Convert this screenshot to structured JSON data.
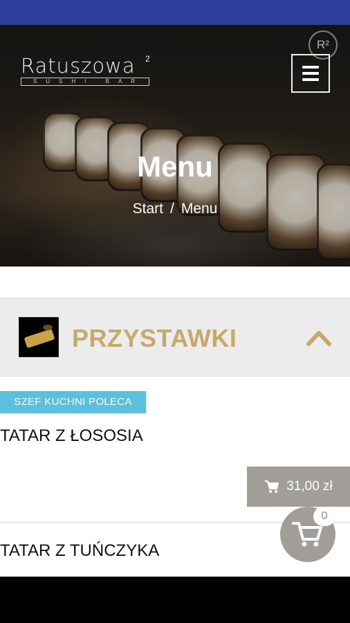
{
  "header": {
    "logo_text": "Ratuszowa",
    "logo_sup": "2",
    "logo_sub": "SUSHI BAR",
    "badge_text": "R²"
  },
  "hero": {
    "title": "Menu",
    "breadcrumb": [
      "Start",
      "Menu"
    ],
    "breadcrumb_separator": "/"
  },
  "category": {
    "title": "PRZYSTAWKI",
    "expanded": true
  },
  "items": [
    {
      "badge": "SZEF KUCHNI POLECA",
      "name": "TATAR Z ŁOSOSIA",
      "price": "31,00 zł"
    },
    {
      "name": "TATAR Z TUŃCZYKA"
    }
  ],
  "cart": {
    "count": "0"
  },
  "colors": {
    "status_bar": "#2f3f9e",
    "accent_gold": "#c8a96c",
    "badge_blue": "#5bc0de",
    "price_gray": "#a19d99"
  },
  "icons": [
    "hamburger-icon",
    "chevron-up-icon",
    "cart-icon"
  ]
}
